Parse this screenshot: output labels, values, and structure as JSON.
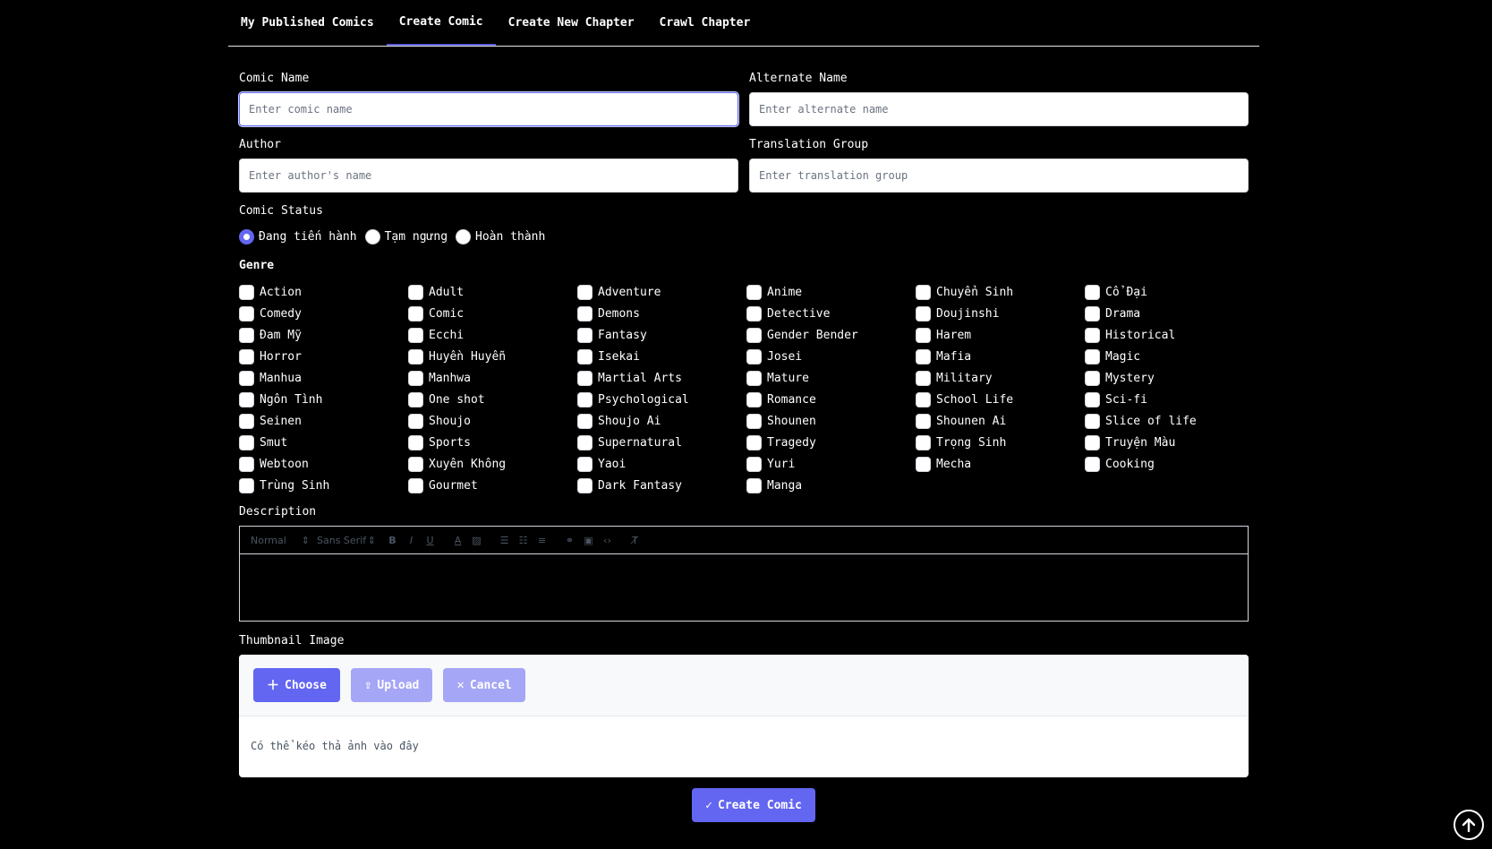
{
  "tabs": [
    {
      "label": "My Published Comics"
    },
    {
      "label": "Create Comic"
    },
    {
      "label": "Create New Chapter"
    },
    {
      "label": "Crawl Chapter"
    }
  ],
  "form": {
    "comic_name": {
      "label": "Comic Name",
      "placeholder": "Enter comic name",
      "value": ""
    },
    "alternate_name": {
      "label": "Alternate Name",
      "placeholder": "Enter alternate name",
      "value": ""
    },
    "author": {
      "label": "Author",
      "placeholder": "Enter author's name",
      "value": ""
    },
    "translation_group": {
      "label": "Translation Group",
      "placeholder": "Enter translation group",
      "value": ""
    },
    "status": {
      "label": "Comic Status",
      "options": [
        "Đang tiến hành",
        "Tạm ngưng",
        "Hoàn thành"
      ],
      "selected": "Đang tiến hành"
    },
    "genre": {
      "label": "Genre",
      "items": [
        "Action",
        "Adult",
        "Adventure",
        "Anime",
        "Chuyển Sinh",
        "Cổ Đại",
        "Comedy",
        "Comic",
        "Demons",
        "Detective",
        "Doujinshi",
        "Drama",
        "Đam Mỹ",
        "Ecchi",
        "Fantasy",
        "Gender Bender",
        "Harem",
        "Historical",
        "Horror",
        "Huyền Huyễn",
        "Isekai",
        "Josei",
        "Mafia",
        "Magic",
        "Manhua",
        "Manhwa",
        "Martial Arts",
        "Mature",
        "Military",
        "Mystery",
        "Ngôn Tình",
        "One shot",
        "Psychological",
        "Romance",
        "School Life",
        "Sci-fi",
        "Seinen",
        "Shoujo",
        "Shoujo Ai",
        "Shounen",
        "Shounen Ai",
        "Slice of life",
        "Smut",
        "Sports",
        "Supernatural",
        "Tragedy",
        "Trọng Sinh",
        "Truyện Màu",
        "Webtoon",
        "Xuyên Không",
        "Yaoi",
        "Yuri",
        "Mecha",
        "Cooking",
        "Trùng Sinh",
        "Gourmet",
        "Dark Fantasy",
        "Manga"
      ]
    },
    "description": {
      "label": "Description",
      "toolbar": {
        "header_select": "Normal",
        "font_select": "Sans Serif"
      }
    },
    "thumbnail": {
      "label": "Thumbnail Image",
      "choose": "Choose",
      "upload": "Upload",
      "cancel": "Cancel",
      "drop_hint": "Có thể kéo thả ảnh vào đây"
    },
    "submit": "Create Comic"
  },
  "colors": {
    "accent": "#6366f1",
    "accent_disabled": "#a5a6f6",
    "background": "#000000"
  }
}
